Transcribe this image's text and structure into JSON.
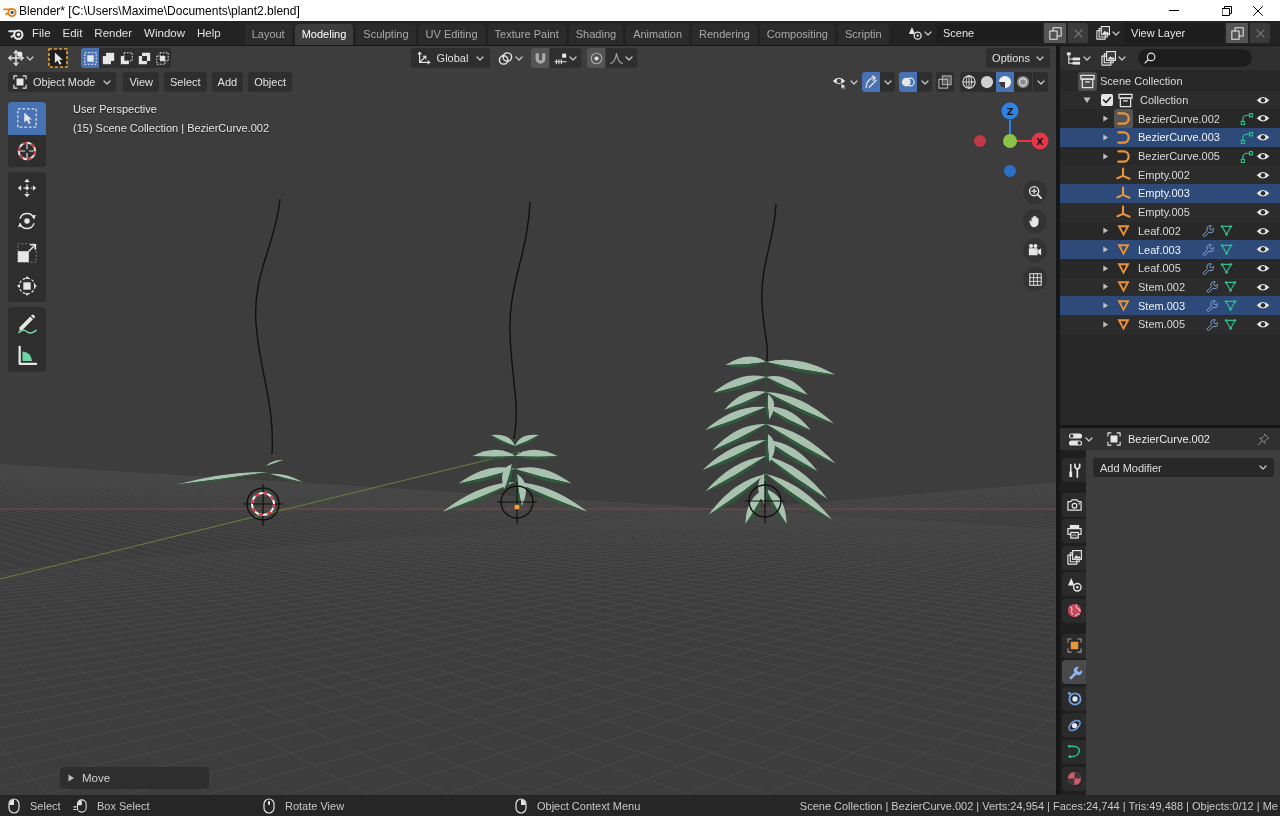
{
  "window": {
    "title": "Blender* [C:\\Users\\Maxime\\Documents\\plant2.blend]"
  },
  "menu": [
    "File",
    "Edit",
    "Render",
    "Window",
    "Help"
  ],
  "workspaces": [
    {
      "label": "Layout",
      "selected": false
    },
    {
      "label": "Modeling",
      "selected": true
    },
    {
      "label": "Sculpting",
      "selected": false
    },
    {
      "label": "UV Editing",
      "selected": false
    },
    {
      "label": "Texture Paint",
      "selected": false
    },
    {
      "label": "Shading",
      "selected": false
    },
    {
      "label": "Animation",
      "selected": false
    },
    {
      "label": "Rendering",
      "selected": false
    },
    {
      "label": "Compositing",
      "selected": false
    },
    {
      "label": "Scriptin",
      "selected": false
    }
  ],
  "scene": {
    "value": "Scene"
  },
  "view_layer": {
    "value": "View Layer"
  },
  "tool_settings": {
    "select_modes": [
      {
        "kind": "set",
        "selected": true
      },
      {
        "kind": "extend",
        "selected": false
      },
      {
        "kind": "subtract",
        "selected": false
      },
      {
        "kind": "difference",
        "selected": false
      },
      {
        "kind": "intersect",
        "selected": false
      }
    ],
    "orientation": "Global",
    "options": "Options"
  },
  "viewport_header": {
    "mode": "Object Mode",
    "menus": [
      "View",
      "Select",
      "Add",
      "Object"
    ],
    "gizmos": true,
    "overlays": true,
    "xray": false,
    "shading": [
      {
        "kind": "wireframe",
        "selected": false
      },
      {
        "kind": "solid",
        "selected": false
      },
      {
        "kind": "material",
        "selected": true
      },
      {
        "kind": "rendered",
        "selected": false
      }
    ]
  },
  "toolbar": {
    "groups": [
      {
        "tools": [
          {
            "kind": "select_box",
            "selected": true
          },
          {
            "kind": "cursor",
            "selected": false
          }
        ]
      },
      {
        "tools": [
          {
            "kind": "move",
            "selected": false
          },
          {
            "kind": "rotate",
            "selected": false
          },
          {
            "kind": "scale",
            "selected": false
          },
          {
            "kind": "transform",
            "selected": false
          }
        ]
      },
      {
        "tools": [
          {
            "kind": "annotate",
            "selected": false
          },
          {
            "kind": "measure",
            "selected": false
          }
        ]
      }
    ]
  },
  "viewport": {
    "view_name": "User Perspective",
    "context": "(15) Scene Collection | BezierCurve.002",
    "axes": [
      {
        "label": "Z",
        "color": "#2e83e6"
      },
      {
        "label": "X",
        "color": "#e8354a"
      }
    ],
    "last_operator": {
      "label": "Move",
      "expanded": false
    }
  },
  "outliner": {
    "root": {
      "label": "Scene Collection",
      "active": true,
      "children": [
        {
          "label": "Collection",
          "active": false,
          "checked": true,
          "expanded": true,
          "visible": true,
          "children": [
            {
              "label": "BezierCurve.002",
              "kind": "curve",
              "selected": false,
              "active": true,
              "visible": true
            },
            {
              "label": "BezierCurve.003",
              "kind": "curve",
              "selected": true,
              "active": false,
              "visible": true
            },
            {
              "label": "BezierCurve.005",
              "kind": "curve",
              "selected": false,
              "active": false,
              "visible": true
            },
            {
              "label": "Empty.002",
              "kind": "empty",
              "selected": false,
              "active": false,
              "visible": true
            },
            {
              "label": "Empty.003",
              "kind": "empty",
              "selected": true,
              "active": false,
              "visible": true
            },
            {
              "label": "Empty.005",
              "kind": "empty",
              "selected": false,
              "active": false,
              "visible": true
            },
            {
              "label": "Leaf.002",
              "kind": "mesh",
              "selected": false,
              "active": false,
              "visible": true
            },
            {
              "label": "Leaf.003",
              "kind": "mesh",
              "selected": true,
              "active": false,
              "visible": true
            },
            {
              "label": "Leaf.005",
              "kind": "mesh",
              "selected": false,
              "active": false,
              "visible": true
            },
            {
              "label": "Stem.002",
              "kind": "mesh",
              "selected": false,
              "active": false,
              "visible": true
            },
            {
              "label": "Stem.003",
              "kind": "mesh",
              "selected": true,
              "active": false,
              "visible": true
            },
            {
              "label": "Stem.005",
              "kind": "mesh",
              "selected": false,
              "active": false,
              "visible": true
            }
          ]
        }
      ]
    }
  },
  "properties": {
    "object": "BezierCurve.002",
    "tab_groups": [
      {
        "tabs": [
          {
            "kind": "tool",
            "selected": false
          }
        ]
      },
      {
        "tabs": [
          {
            "kind": "render",
            "selected": false
          },
          {
            "kind": "output",
            "selected": false
          },
          {
            "kind": "view_layer",
            "selected": false
          },
          {
            "kind": "scene",
            "selected": false
          },
          {
            "kind": "world",
            "selected": false
          }
        ]
      },
      {
        "tabs": [
          {
            "kind": "object",
            "selected": false
          },
          {
            "kind": "modifiers",
            "selected": true
          },
          {
            "kind": "particles",
            "selected": false
          },
          {
            "kind": "physics",
            "selected": false
          },
          {
            "kind": "data",
            "selected": false
          },
          {
            "kind": "material",
            "selected": false
          }
        ]
      }
    ],
    "add_modifier": "Add Modifier"
  },
  "status_bar": {
    "hints": [
      {
        "kind": "left_click",
        "label": "Select"
      },
      {
        "kind": "drag",
        "label": "Box Select"
      },
      {
        "kind": "middle_click",
        "label": "Rotate View"
      },
      {
        "kind": "right_click",
        "label": "Object Context Menu"
      }
    ],
    "stats": "Scene Collection | BezierCurve.002 | Verts:24,954 | Faces:24,744 | Tris:49,488 | Objects:0/12 | Me"
  }
}
